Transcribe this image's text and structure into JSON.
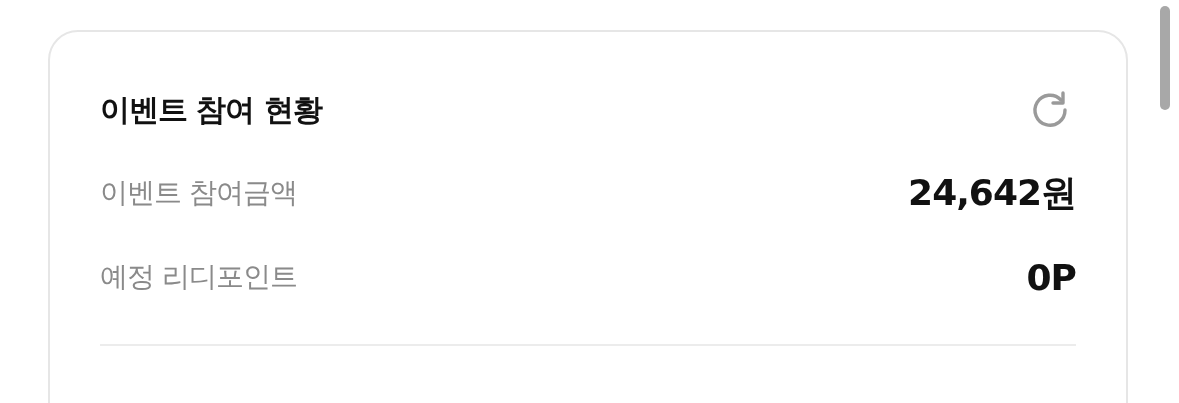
{
  "card": {
    "title": "이벤트 참여 현황",
    "rows": [
      {
        "label": "이벤트 참여금액",
        "value": "24,642원"
      },
      {
        "label": "예정 리디포인트",
        "value": "0P"
      }
    ]
  }
}
